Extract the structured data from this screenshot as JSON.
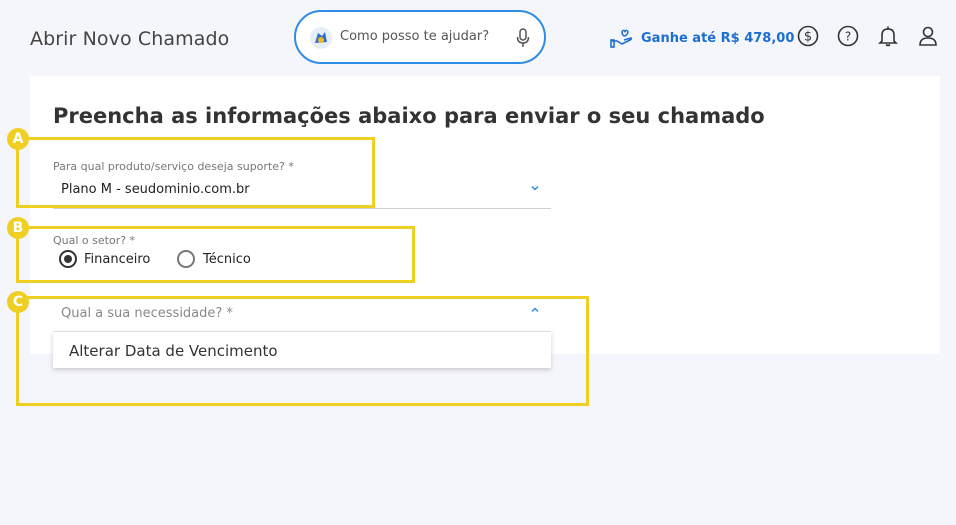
{
  "header": {
    "title": "Abrir Novo Chamado",
    "assistant_placeholder": "Como posso te ajudar?",
    "promo_text": "Ganhe até R$ 478,00",
    "icons": [
      "assistant-avatar-icon",
      "microphone-icon",
      "gift-hand-icon",
      "dollar-icon",
      "help-icon",
      "bell-icon",
      "user-icon"
    ]
  },
  "form": {
    "title": "Preencha as informações abaixo para enviar o seu chamado",
    "product": {
      "label": "Para qual produto/serviço deseja suporte? *",
      "value": "Plano M - seudominio.com.br"
    },
    "sector": {
      "label": "Qual o setor? *",
      "options": [
        {
          "label": "Financeiro",
          "selected": true
        },
        {
          "label": "Técnico",
          "selected": false
        }
      ]
    },
    "need": {
      "label": "Qual a sua necessidade? *",
      "options": [
        "Alterar Data de Vencimento"
      ]
    }
  },
  "annotations": {
    "badges": [
      "A",
      "B",
      "C"
    ],
    "highlight_color": "#f0cf23"
  },
  "colors": {
    "accent": "#2f8ce6",
    "promo": "#1c6fd1"
  }
}
